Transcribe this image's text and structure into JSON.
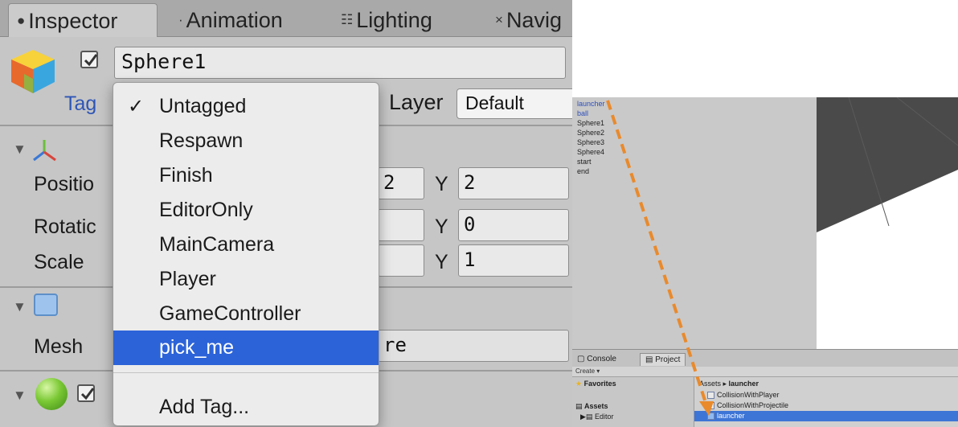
{
  "inspector": {
    "tabs": [
      {
        "label": "Inspector",
        "icon": "info-icon"
      },
      {
        "label": "Animation",
        "icon": "animation-icon"
      },
      {
        "label": "Lighting",
        "icon": "lighting-icon"
      },
      {
        "label": "Navig",
        "icon": "navigation-icon"
      }
    ],
    "object_name": "Sphere1",
    "tag_label": "Tag",
    "layer_label": "Layer",
    "layer_value": "Default",
    "transform": {
      "rows": [
        {
          "label": "Positio",
          "x_partial": "2",
          "y_axis": "Y",
          "y": "2"
        },
        {
          "label": "Rotatic",
          "y_axis": "Y",
          "y": "0"
        },
        {
          "label": "Scale",
          "y_axis": "Y",
          "y": "1"
        }
      ]
    },
    "mesh": {
      "label": "Mesh",
      "value_partial": "re"
    }
  },
  "tag_menu": {
    "items": [
      "Untagged",
      "Respawn",
      "Finish",
      "EditorOnly",
      "MainCamera",
      "Player",
      "GameController",
      "pick_me"
    ],
    "checked": "Untagged",
    "highlighted": "pick_me",
    "add_tag": "Add Tag..."
  },
  "editor": {
    "hierarchy": [
      "launcher",
      "ball",
      "Sphere1",
      "Sphere2",
      "Sphere3",
      "Sphere4",
      "start",
      "end"
    ],
    "tabs": [
      "Console",
      "Project"
    ],
    "create_label": "Create ▾",
    "favorites": "Favorites",
    "assets": "Assets",
    "editor_folder": "Editor",
    "breadcrumb": [
      "Assets",
      "launcher"
    ],
    "files": [
      "CollisionWithPlayer",
      "CollisionWithProjectile",
      "launcher"
    ]
  },
  "colors": {
    "highlight": "#2c63d8",
    "drag_arrow": "#e98a2c",
    "tag_link": "#2e55b6"
  }
}
